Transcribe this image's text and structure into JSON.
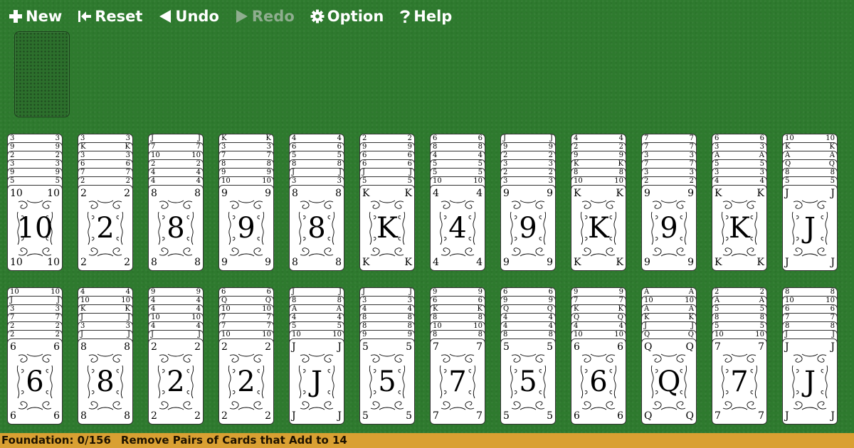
{
  "toolbar": {
    "new_label": "New",
    "reset_label": "Reset",
    "undo_label": "Undo",
    "redo_label": "Redo",
    "option_label": "Option",
    "help_label": "Help"
  },
  "status": {
    "foundation": "Foundation: 0/156",
    "message": "Remove Pairs of Cards that Add to 14"
  },
  "rows": [
    [
      {
        "stack": [
          "3",
          "9",
          "2",
          "3",
          "9",
          "5"
        ],
        "top": "10"
      },
      {
        "stack": [
          "3",
          "K",
          "3",
          "6",
          "7",
          "2"
        ],
        "top": "2"
      },
      {
        "stack": [
          "J",
          "7",
          "10",
          "2",
          "4",
          "4"
        ],
        "top": "8"
      },
      {
        "stack": [
          "K",
          "3",
          "7",
          "8",
          "9",
          "10"
        ],
        "top": "9"
      },
      {
        "stack": [
          "4",
          "6",
          "5",
          "8",
          "J",
          "3"
        ],
        "top": "8"
      },
      {
        "stack": [
          "2",
          "9",
          "6",
          "6",
          "J",
          "5"
        ],
        "top": "K"
      },
      {
        "stack": [
          "6",
          "8",
          "4",
          "5",
          "5",
          "10"
        ],
        "top": "4"
      },
      {
        "stack": [
          "J",
          "9",
          "2",
          "3",
          "2",
          "3"
        ],
        "top": "9"
      },
      {
        "stack": [
          "4",
          "2",
          "9",
          "K",
          "8",
          "10"
        ],
        "top": "K"
      },
      {
        "stack": [
          "7",
          "7",
          "3",
          "7",
          "3",
          "2"
        ],
        "top": "9"
      },
      {
        "stack": [
          "6",
          "3",
          "A",
          "5",
          "3",
          "4"
        ],
        "top": "K"
      },
      {
        "stack": [
          "10",
          "K",
          "A",
          "Q",
          "8",
          "5"
        ],
        "top": "J"
      }
    ],
    [
      {
        "stack": [
          "10",
          "J",
          "3",
          "7",
          "2",
          "2"
        ],
        "top": "6"
      },
      {
        "stack": [
          "4",
          "10",
          "K",
          "J",
          "3",
          "J"
        ],
        "top": "8"
      },
      {
        "stack": [
          "9",
          "4",
          "4",
          "10",
          "4",
          "J"
        ],
        "top": "2"
      },
      {
        "stack": [
          "6",
          "Q",
          "10",
          "7",
          "7",
          "10"
        ],
        "top": "2"
      },
      {
        "stack": [
          "J",
          "8",
          "A",
          "4",
          "5",
          "10"
        ],
        "top": "J"
      },
      {
        "stack": [
          "J",
          "3",
          "4",
          "8",
          "8",
          "9"
        ],
        "top": "5"
      },
      {
        "stack": [
          "9",
          "6",
          "K",
          "8",
          "10",
          "8"
        ],
        "top": "7"
      },
      {
        "stack": [
          "6",
          "9",
          "Q",
          "4",
          "4",
          "8"
        ],
        "top": "5"
      },
      {
        "stack": [
          "9",
          "7",
          "K",
          "Q",
          "4",
          "10"
        ],
        "top": "6"
      },
      {
        "stack": [
          "A",
          "10",
          "A",
          "K",
          "J",
          "Q"
        ],
        "top": "Q"
      },
      {
        "stack": [
          "2",
          "A",
          "5",
          "8",
          "5",
          "10"
        ],
        "top": "7"
      },
      {
        "stack": [
          "8",
          "10",
          "6",
          "7",
          "8",
          "J"
        ],
        "top": "J"
      }
    ]
  ]
}
